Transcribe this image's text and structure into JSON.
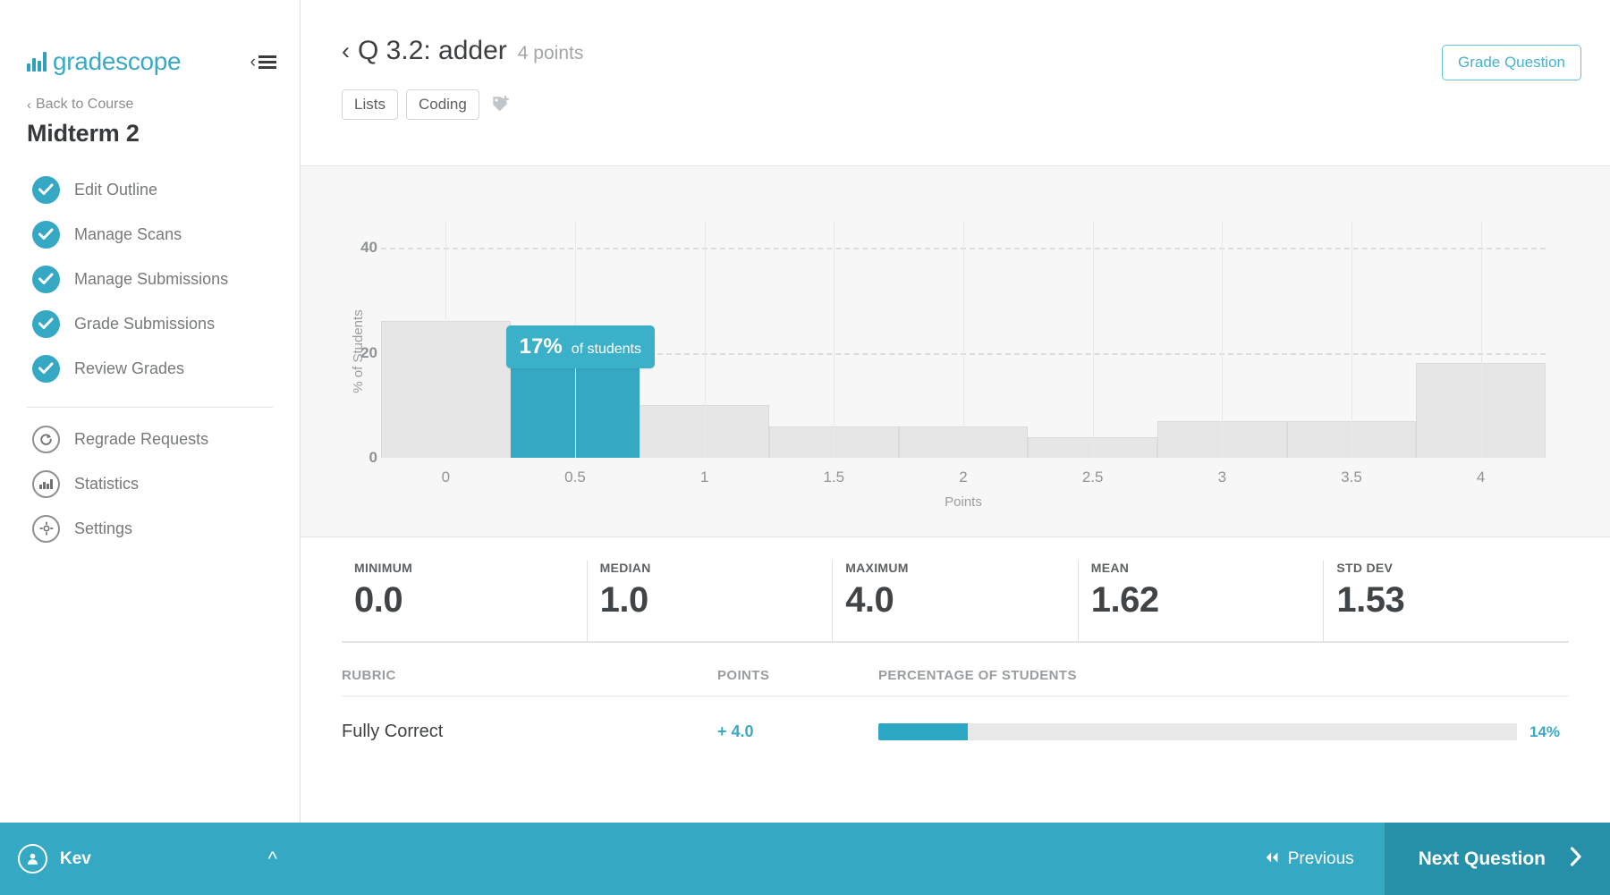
{
  "sidebar": {
    "brand": "gradescope",
    "collapse_icon": "collapse-menu-icon",
    "back_link": "Back to Course",
    "course_title": "Midterm 2",
    "workflow_items": [
      {
        "label": "Edit Outline",
        "icon": "check-circle-icon"
      },
      {
        "label": "Manage Scans",
        "icon": "check-circle-icon"
      },
      {
        "label": "Manage Submissions",
        "icon": "check-circle-icon"
      },
      {
        "label": "Grade Submissions",
        "icon": "check-circle-icon"
      },
      {
        "label": "Review Grades",
        "icon": "check-circle-icon"
      }
    ],
    "secondary_items": [
      {
        "label": "Regrade Requests",
        "icon": "regrade-circle-icon"
      },
      {
        "label": "Statistics",
        "icon": "statistics-circle-icon"
      },
      {
        "label": "Settings",
        "icon": "gear-circle-icon"
      }
    ],
    "user": {
      "name": "Kev",
      "avatar_icon": "user-avatar-icon",
      "chevron": "chevron-up-icon"
    }
  },
  "header": {
    "back_chevron": "chevron-left-icon",
    "question_title": "Q 3.2: adder",
    "points": "4 points",
    "grade_button": "Grade Question",
    "tags": [
      "Lists",
      "Coding"
    ],
    "add_tag_icon": "tag-plus-icon"
  },
  "chart_data": {
    "type": "bar",
    "title": "",
    "xlabel": "Points",
    "ylabel": "% of Students",
    "x_tick_labels": [
      "0",
      "0.5",
      "1",
      "1.5",
      "2",
      "2.5",
      "3",
      "3.5",
      "4"
    ],
    "y_tick_labels": [
      "40",
      "20",
      "0"
    ],
    "ylim": [
      0,
      45
    ],
    "xlim": [
      -0.25,
      4.25
    ],
    "grid": "horizontal-dashed-and-vertical-solid",
    "legend": "none",
    "bin_width": 0.5,
    "categories": [
      "0",
      "0.5",
      "1",
      "1.5",
      "2",
      "2.5",
      "3",
      "3.5",
      "4"
    ],
    "values": [
      26,
      17,
      10,
      6,
      6,
      4,
      7,
      7,
      18
    ],
    "highlight_index": 1,
    "highlight_color": "#35a8c4",
    "bar_color": "#e6e6e6",
    "tooltip": {
      "percent": "17%",
      "label": "of students"
    }
  },
  "stats": [
    {
      "label": "MINIMUM",
      "value": "0.0"
    },
    {
      "label": "MEDIAN",
      "value": "1.0"
    },
    {
      "label": "MAXIMUM",
      "value": "4.0"
    },
    {
      "label": "MEAN",
      "value": "1.62"
    },
    {
      "label": "STD DEV",
      "value": "1.53"
    }
  ],
  "rubric": {
    "headers": {
      "name": "RUBRIC",
      "points": "POINTS",
      "percentage": "PERCENTAGE OF STUDENTS"
    },
    "rows": [
      {
        "name": "Fully Correct",
        "points": "+ 4.0",
        "percent_label": "14%",
        "percent_value": 14
      }
    ]
  },
  "bottom_nav": {
    "previous": "Previous",
    "previous_icon": "double-chevron-left-icon",
    "next": "Next Question",
    "next_icon": "chevron-right-icon"
  },
  "colors": {
    "accent": "#35a8c4",
    "accent_dark": "#2690a9",
    "bar_grey": "#e6e6e6"
  }
}
